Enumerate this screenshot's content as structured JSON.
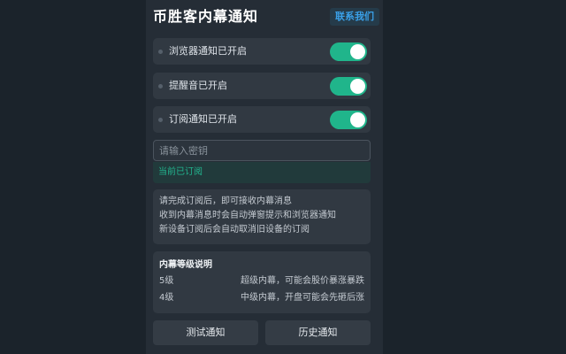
{
  "header": {
    "title": "币胜客内幕通知",
    "contact_label": "联系我们"
  },
  "settings": [
    {
      "label": "浏览器通知已开启",
      "enabled": true
    },
    {
      "label": "提醒音已开启",
      "enabled": true
    },
    {
      "label": "订阅通知已开启",
      "enabled": true
    }
  ],
  "key_input": {
    "placeholder": "请输入密钥",
    "value": ""
  },
  "subscription_status": "当前已订阅",
  "info": {
    "lines": [
      "请完成订阅后，即可接收内幕消息",
      "收到内幕消息时会自动弹窗提示和浏览器通知",
      "新设备订阅后会自动取消旧设备的订阅"
    ]
  },
  "levels": {
    "title": "内幕等级说明",
    "items": [
      {
        "level": "5级",
        "desc": "超级内幕，可能会股价暴涨暴跌"
      },
      {
        "level": "4级",
        "desc": "中级内幕，开盘可能会先砸后涨"
      }
    ]
  },
  "buttons": {
    "test_label": "测试通知",
    "history_label": "历史通知"
  },
  "colors": {
    "accent_green": "#20b58b",
    "link_blue": "#3aa0e8",
    "panel_bg": "#252d36"
  }
}
